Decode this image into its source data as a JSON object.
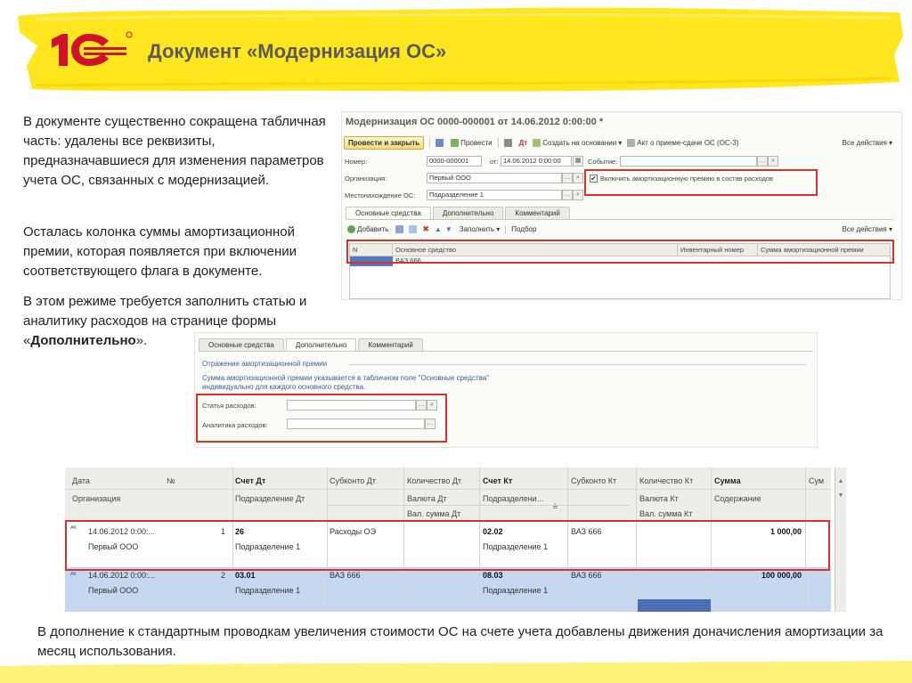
{
  "slide": {
    "title": "Документ «Модернизация ОС»",
    "paragraphs": [
      "В документе существенно сокращена табличная часть: удалены все реквизиты, предназначавшиеся для изменения параметров учета ОС, связанных с модернизацией.",
      "Осталась колонка суммы амортизационной премии, которая появляется при включении соответствующего флага в документе."
    ],
    "p3_before": "В этом режиме требуется заполнить статью и аналитику расходов на странице формы «",
    "p3_bold": "Дополнительно",
    "p3_after": "».",
    "bottom": "В дополнение к стандартным проводкам увеличения стоимости ОС на счете учета добавлены движения доначисления амортизации за месяц использования."
  },
  "colors": {
    "brand_red": "#d0112b",
    "highlight": "#d2332c",
    "brush_yellow": "#ffe61e",
    "selected_row": "#c5d8f0"
  },
  "form": {
    "title": "Модернизация ОС 0000-000001 от 14.06.2012 0:00:00 *",
    "toolbar": {
      "post_close": "Провести и закрыть",
      "post": "Провести",
      "create_based": "Создать на основании",
      "act": "Акт о приеме-сдаче ОС (ОС-3)",
      "all_actions": "Все действия"
    },
    "number_label": "Номер:",
    "number_value": "0000-000001",
    "from_label": "от:",
    "date_value": "14.06.2012 0:00:00",
    "event_label": "Событие:",
    "event_value": "",
    "org_label": "Организация:",
    "org_value": "Первый ООО",
    "location_label": "Местонахождение ОС:",
    "location_value": "Подразделение 1",
    "flag_label": "Включить амортизационную премию в состав расходов",
    "flag_checked": true,
    "tabs": [
      "Основные средства",
      "Дополнительно",
      "Комментарий"
    ],
    "tab_toolbar": {
      "add": "Добавить",
      "fill": "Заполнить",
      "pick": "Подбор",
      "all_actions": "Все действия"
    },
    "columns": [
      "N",
      "Основное средство",
      "Инвентарный номер",
      "Сумма амортизационной премии"
    ],
    "rows": [
      {
        "n": "1",
        "asset": "ВАЗ 666",
        "inv": "",
        "sum": ""
      }
    ]
  },
  "form2": {
    "tabs": [
      "Основные средства",
      "Дополнительно",
      "Комментарий"
    ],
    "section": "Отражение амортизационной премии",
    "note_line1": "Сумма амортизационной премии указывается в табличном поле \"Основные средства\"",
    "note_line2": "индивидуально для каждого основного средства.",
    "expense_item_label": "Статья расходов:",
    "expense_item_value": "",
    "analytics_label": "Аналитика расходов:",
    "analytics_value": ""
  },
  "journal": {
    "headers": {
      "date": "Дата",
      "num": "№",
      "org": "Организация",
      "acc_dt": "Счет Дт",
      "dept_dt": "Подразделение Дт",
      "subconto_dt": "Субконто Дт",
      "qty_dt": "Количество Дт",
      "cur_dt": "Валюта Дт",
      "cur_sum_dt": "Вал. сумма Дт",
      "acc_kt": "Счет Кт",
      "dept_kt": "Подразделени...",
      "subconto_kt": "Субконто Кт",
      "qty_kt": "Количество Кт",
      "cur_kt": "Валюта Кт",
      "cur_sum_kt": "Вал. сумма Кт",
      "sum": "Сумма",
      "content": "Содержание",
      "extra": "Сум"
    },
    "rows": [
      {
        "date": "14.06.2012 0:00:...",
        "num": "1",
        "org": "Первый ООО",
        "acc_dt": "26",
        "dept_dt": "Подразделение 1",
        "subconto_dt": "Расходы ОЭ",
        "acc_kt": "02.02",
        "dept_kt": "Подразделение 1",
        "subconto_kt": "ВАЗ 666",
        "sum": "1 000,00"
      },
      {
        "date": "14.06.2012 0:00:...",
        "num": "2",
        "org": "Первый ООО",
        "acc_dt": "03.01",
        "dept_dt": "Подразделение 1",
        "subconto_dt": "ВАЗ 666",
        "acc_kt": "08.03",
        "dept_kt": "Подразделение 1",
        "subconto_kt": "ВАЗ 666",
        "sum": "100 000,00"
      }
    ]
  }
}
